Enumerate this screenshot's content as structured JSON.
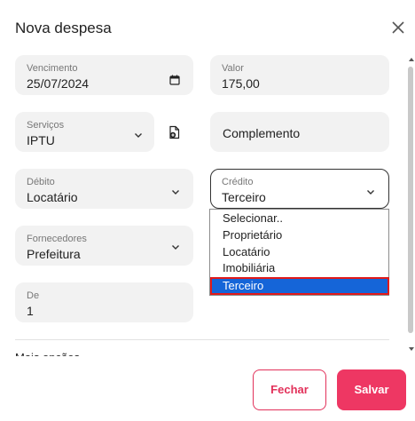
{
  "dialog": {
    "title": "Nova despesa"
  },
  "fields": {
    "vencimento": {
      "label": "Vencimento",
      "value": "25/07/2024"
    },
    "valor": {
      "label": "Valor",
      "value": "175,00"
    },
    "servicos": {
      "label": "Serviços",
      "value": "IPTU"
    },
    "complemento": {
      "placeholder": "Complemento"
    },
    "debito": {
      "label": "Débito",
      "value": "Locatário"
    },
    "credito": {
      "label": "Crédito",
      "value": "Terceiro"
    },
    "fornecedores": {
      "label": "Fornecedores",
      "value": "Prefeitura"
    },
    "de": {
      "label": "De",
      "value": "1"
    }
  },
  "credito_dropdown": {
    "options": [
      "Selecionar..",
      "Proprietário",
      "Locatário",
      "Imobiliária",
      "Terceiro"
    ],
    "highlighted": "Terceiro"
  },
  "clipped_section_label": "Mais opções",
  "buttons": {
    "close_label": "Fechar",
    "save_label": "Salvar"
  },
  "colors": {
    "primary": "#ee3763",
    "outline": "#e2315a",
    "field_bg": "#f2f2f2",
    "selection": "#1565d8",
    "highlight_box": "#e11a1a"
  },
  "icons": [
    "close-icon",
    "calendar-icon",
    "chevron-down-icon",
    "add-document-icon"
  ]
}
